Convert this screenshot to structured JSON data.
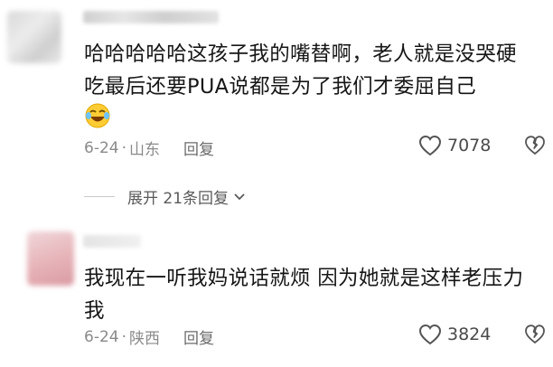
{
  "comments": [
    {
      "text": "哈哈哈哈哈这孩子我的嘴替啊，老人就是没哭硬吃最后还要PUA说都是为了我们才委屈自己",
      "emoji": "laughing-crying-emoji",
      "date": "6-24",
      "location": "山东",
      "reply_label": "回复",
      "likes": "7078"
    },
    {
      "text": "我现在一听我妈说话就烦 因为她就是这样老压力我",
      "date": "6-24",
      "location": "陕西",
      "reply_label": "回复",
      "likes": "3824"
    }
  ],
  "expand_replies_label": "展开 21条回复",
  "colors": {
    "meta_gray": "#8a8a8a",
    "avatar_blur_pink": "#e6b3b8"
  }
}
